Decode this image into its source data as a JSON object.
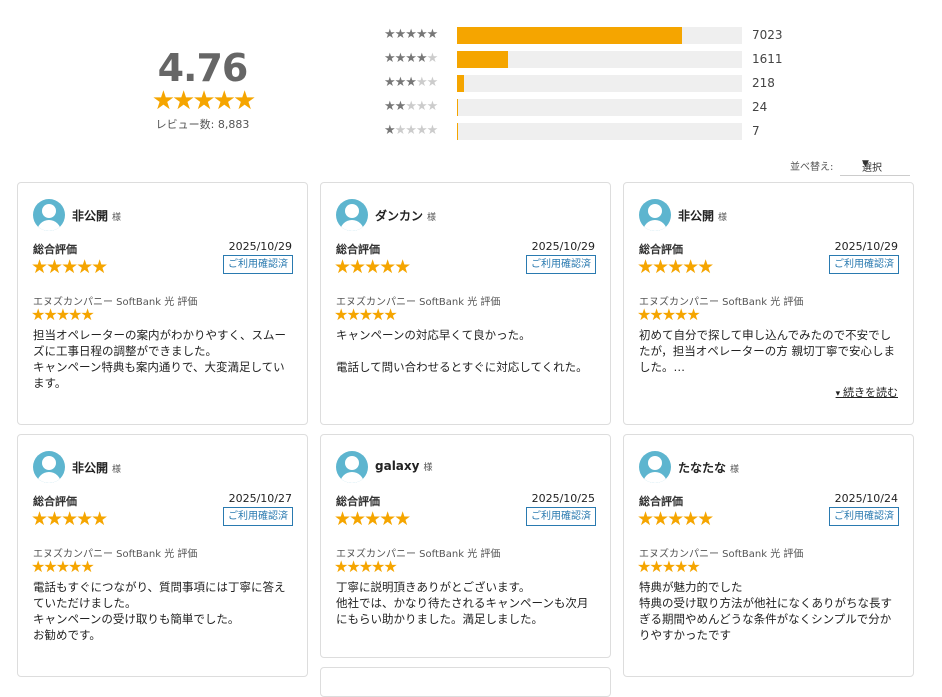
{
  "summary": {
    "average": "4.76",
    "stars": "★★★★★",
    "review_count": "レビュー数: 8,883"
  },
  "distribution": [
    {
      "stars_on": "★★★★★",
      "stars_off": "",
      "count": "7023",
      "fraction": 0.79
    },
    {
      "stars_on": "★★★★",
      "stars_off": "★",
      "count": "1611",
      "fraction": 0.18
    },
    {
      "stars_on": "★★★",
      "stars_off": "★★",
      "count": "218",
      "fraction": 0.025
    },
    {
      "stars_on": "★★",
      "stars_off": "★★★",
      "count": "24",
      "fraction": 0.004
    },
    {
      "stars_on": "★",
      "stars_off": "★★★★",
      "count": "7",
      "fraction": 0.002
    }
  ],
  "sort": {
    "label": "並べ替え:",
    "selected": "選択",
    "caret": "▼"
  },
  "labels": {
    "honorific": "様",
    "overall": "総合評価",
    "badge": "ご利用確認済",
    "sub_rating": "エヌズカンパニー SoftBank 光 評価",
    "star5": "★★★★★",
    "read_more": "続きを読む"
  },
  "reviews": [
    {
      "name": "非公開",
      "date": "2025/10/29",
      "comment": "担当オペレーターの案内がわかりやすく、スムーズに工事日程の調整ができました。\nキャンペーン特典も案内通りで、大変満足しています。"
    },
    {
      "name": "ダンカン",
      "date": "2025/10/29",
      "comment": "キャンペーンの対応早くて良かった。\n\n電話して問い合わせるとすぐに対応してくれた。"
    },
    {
      "name": "非公開",
      "date": "2025/10/29",
      "comment": "初めて自分で探して申し込んでみたので不安でしたが，担当オペレーターの方 親切丁寧で安心しました。…"
    },
    {
      "name": "非公開",
      "date": "2025/10/27",
      "comment": "電話もすぐにつながり、質問事項には丁寧に答えていただけました。\nキャンペーンの受け取りも簡単でした。\nお勧めです。"
    },
    {
      "name": "galaxy",
      "date": "2025/10/25",
      "comment": "丁寧に説明頂きありがとございます。\n他社では、かなり待たされるキャンペーンも次月にもらい助かりました。満足しました。"
    },
    {
      "name": "たなたな",
      "date": "2025/10/24",
      "comment": "特典が魅力的でした\n特典の受け取り方法が他社になくありがちな長すぎる期間やめんどうな条件がなくシンプルで分かりやすかったです"
    }
  ]
}
